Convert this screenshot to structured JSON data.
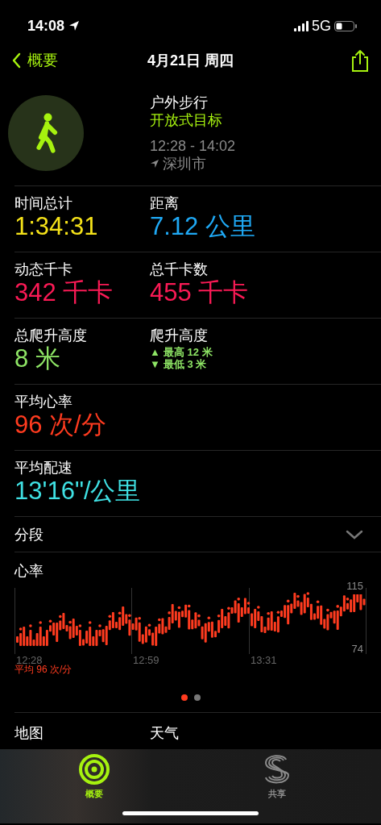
{
  "status_bar": {
    "time": "14:08",
    "network": "5G"
  },
  "nav": {
    "back": "概要",
    "title": "4月21日 周四"
  },
  "workout": {
    "type": "户外步行",
    "goal": "开放式目标",
    "time_range": "12:28 - 14:02",
    "location": "深圳市"
  },
  "metric_rows": [
    {
      "cells": [
        {
          "kind": "value",
          "label": "时间总计",
          "value": "1:34:31",
          "color": "#f5e219"
        },
        {
          "kind": "value",
          "label": "距离",
          "value": "7.12 公里",
          "color": "#1fa9f5"
        }
      ]
    },
    {
      "cells": [
        {
          "kind": "value",
          "label": "动态千卡",
          "value": "342 千卡",
          "color": "#fa1a55"
        },
        {
          "kind": "value",
          "label": "总千卡数",
          "value": "455 千卡",
          "color": "#fa1a55"
        }
      ]
    },
    {
      "cells": [
        {
          "kind": "value",
          "label": "总爬升高度",
          "value": "8 米",
          "color": "#8ee565"
        },
        {
          "kind": "range",
          "label": "爬升高度",
          "high_marker": "▲",
          "high": "最高 12 米",
          "low_marker": "▼",
          "low": "最低 3 米",
          "color": "#8ee565"
        }
      ]
    },
    {
      "cells": [
        {
          "kind": "value",
          "label": "平均心率",
          "value": "96 次/分",
          "color": "#ff3b1f"
        }
      ]
    },
    {
      "cells": [
        {
          "kind": "value",
          "label": "平均配速",
          "value": "13'16\"/公里",
          "color": "#3fe0e3"
        }
      ]
    }
  ],
  "splits": {
    "label": "分段",
    "expanded": false
  },
  "heart_rate": {
    "title": "心率",
    "y_max_label": "115",
    "y_min_label": "74",
    "time_labels": [
      "12:28",
      "12:59",
      "13:31"
    ],
    "average": "平均 96 次/分",
    "pages": [
      {
        "selected": true
      },
      {
        "selected": false
      }
    ]
  },
  "bottom_row": [
    "地图",
    "天气"
  ],
  "tab_bar": [
    {
      "label": "概要",
      "selected": true
    },
    {
      "label": "共享",
      "selected": false
    }
  ]
}
